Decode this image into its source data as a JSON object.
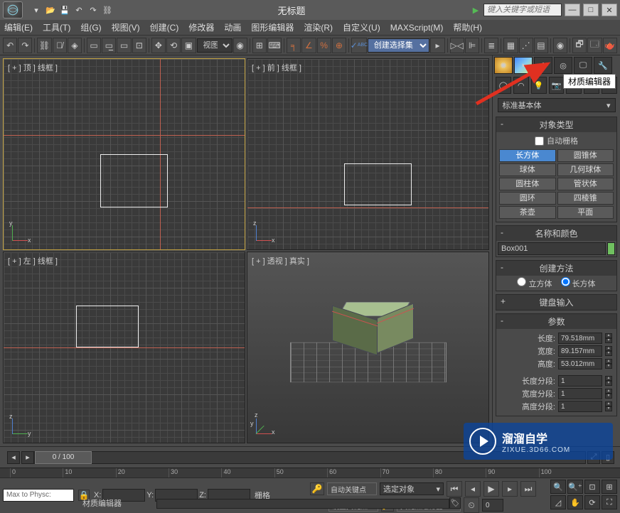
{
  "title": "无标题",
  "search_placeholder": "键入关键字或短语",
  "menu": [
    "编辑(E)",
    "工具(T)",
    "组(G)",
    "视图(V)",
    "创建(C)",
    "修改器",
    "动画",
    "图形编辑器",
    "渲染(R)",
    "自定义(U)",
    "MAXScript(M)",
    "帮助(H)"
  ],
  "toolbar": {
    "ref_coord": "视图",
    "selection_set": "创建选择集"
  },
  "tooltip": "材质编辑器",
  "viewports": {
    "tl": "[ + ] 顶 ] 线框 ]",
    "tr": "[ + ] 前 ] 线框 ]",
    "bl": "[ + ] 左 ] 线框 ]",
    "br": "[ + ] 透视 ] 真实 ]"
  },
  "panel": {
    "category": "标准基本体",
    "rollout_type": "对象类型",
    "autogrid": "自动栅格",
    "types": [
      [
        "长方体",
        "圆锥体"
      ],
      [
        "球体",
        "几何球体"
      ],
      [
        "圆柱体",
        "管状体"
      ],
      [
        "圆环",
        "四棱锥"
      ],
      [
        "茶壶",
        "平面"
      ]
    ],
    "rollout_name": "名称和颜色",
    "obj_name": "Box001",
    "rollout_method": "创建方法",
    "radio1": "立方体",
    "radio2": "长方体",
    "rollout_kb": "键盘输入",
    "rollout_params": "参数",
    "params": {
      "length_lbl": "长度:",
      "length": "79.518mm",
      "width_lbl": "宽度:",
      "width": "89.157mm",
      "height_lbl": "高度:",
      "height": "53.012mm",
      "lseg_lbl": "长度分段:",
      "lseg": "1",
      "wseg_lbl": "宽度分段:",
      "wseg": "1",
      "hseg_lbl": "高度分段:",
      "hseg": "1"
    }
  },
  "timeline": {
    "pos": "0 / 100",
    "ticks": [
      "0",
      "10",
      "20",
      "30",
      "40",
      "50",
      "60",
      "70",
      "80",
      "90",
      "100"
    ]
  },
  "status": {
    "script": "Max to Physc:",
    "hint": "材质编辑器",
    "xl": "X:",
    "yl": "Y:",
    "zl": "Z:",
    "grid": "栅格",
    "autokey": "自动关键点",
    "setkey": "设置关键点",
    "sel_label": "选定对象",
    "filter": "关键点过滤器..."
  },
  "watermark": {
    "t1": "溜溜自学",
    "t2": "ZIXUE.3D66.COM"
  },
  "gizmo": {
    "x": "x",
    "y": "y",
    "z": "z"
  }
}
